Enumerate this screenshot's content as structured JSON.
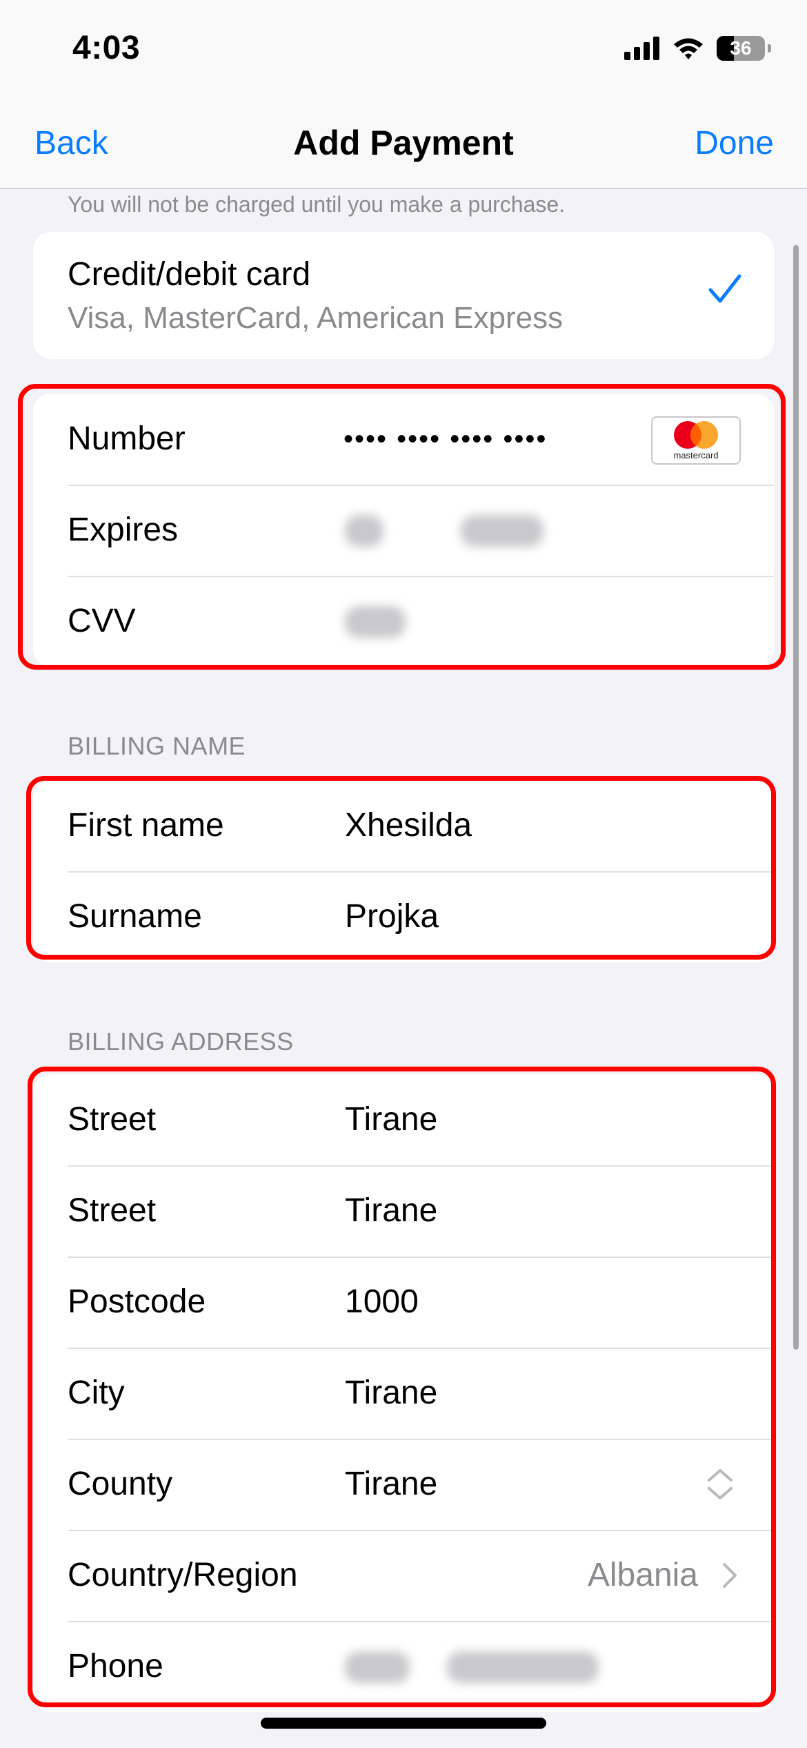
{
  "status_bar": {
    "time": "4:03",
    "battery": "36",
    "battery_level": 0.36,
    "icons": [
      "cellular-signal-icon",
      "wifi-icon",
      "battery-icon"
    ]
  },
  "nav": {
    "back_label": "Back",
    "title": "Add Payment",
    "done_label": "Done"
  },
  "payment_note": "You will not be charged until you make a purchase.",
  "payment_method": {
    "title": "Credit/debit card",
    "subtitle": "Visa, MasterCard, American Express",
    "selected": true
  },
  "card_details": {
    "number_label": "Number",
    "number_value": "•••• •••• •••• ••••",
    "card_brand": "mastercard",
    "expires_label": "Expires",
    "cvv_label": "CVV"
  },
  "billing_name": {
    "header": "BILLING NAME",
    "first_name_label": "First name",
    "first_name_value": "Xhesilda",
    "surname_label": "Surname",
    "surname_value": "Projka"
  },
  "billing_address": {
    "header": "BILLING ADDRESS",
    "rows": [
      {
        "label": "Street",
        "value": "Tirane"
      },
      {
        "label": "Street",
        "value": "Tirane"
      },
      {
        "label": "Postcode",
        "value": "1000"
      },
      {
        "label": "City",
        "value": "Tirane"
      },
      {
        "label": "County",
        "value": "Tirane"
      }
    ],
    "country_label": "Country/Region",
    "country_value": "Albania",
    "phone_label": "Phone"
  },
  "colors": {
    "accent": "#0a7cff",
    "highlight": "#ff0000",
    "background": "#f2f2f7",
    "secondary_text": "#8a8a8e"
  }
}
